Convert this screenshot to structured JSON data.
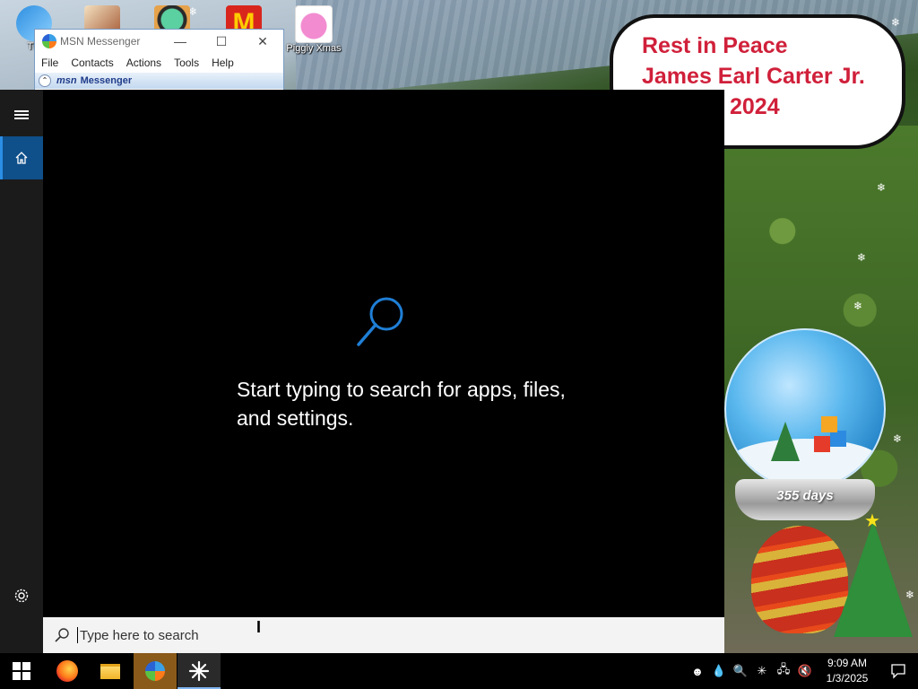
{
  "desktop": {
    "icons": [
      {
        "label": "Thi"
      },
      {
        "label": ""
      },
      {
        "label": ""
      },
      {
        "label": ""
      },
      {
        "label": "Piggly Xmas"
      }
    ],
    "memorial": {
      "line1": "Rest in Peace",
      "line2": "James Earl Carter Jr.",
      "line3": "2024"
    },
    "snow_globe": {
      "counter": "355 days"
    }
  },
  "msn_window": {
    "title": "MSN Messenger",
    "menu": [
      "File",
      "Contacts",
      "Actions",
      "Tools",
      "Help"
    ],
    "banner_brand": "msn",
    "banner_text": "Messenger"
  },
  "search": {
    "prompt": "Start typing to search for apps, files, and settings.",
    "placeholder": "Type here to search",
    "value": ""
  },
  "taskbar": {
    "apps": [
      "start",
      "firefox",
      "file-explorer",
      "msn-messenger",
      "search-app"
    ],
    "clock": {
      "time": "9:09 AM",
      "date": "1/3/2025"
    }
  },
  "colors": {
    "accent": "#0f4f8a",
    "search_icon": "#2b8fe6",
    "memorial_text": "#d0203a"
  }
}
